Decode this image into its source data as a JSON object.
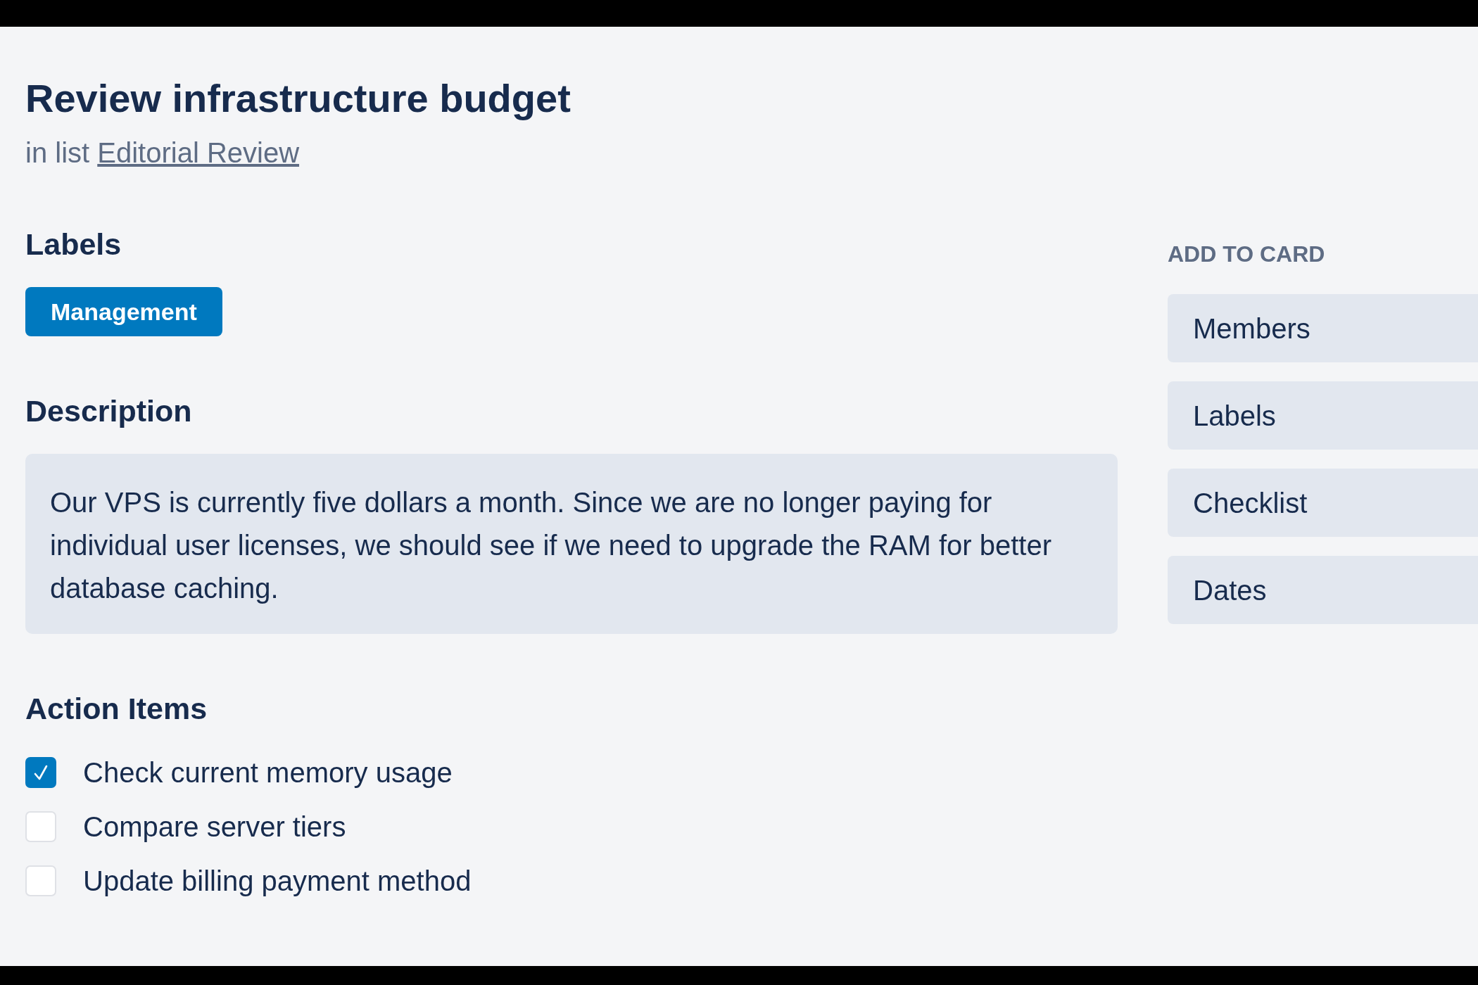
{
  "card": {
    "title": "Review infrastructure budget",
    "list_text": "in list",
    "list_link": "Editorial Review"
  },
  "labels": {
    "heading": "Labels",
    "items": [
      {
        "text": "Management",
        "color": "#0079bf"
      }
    ]
  },
  "description": {
    "heading": "Description",
    "text": "Our VPS is currently five dollars a month. Since we are no longer paying for individual user licenses, we should see if we need to upgrade the RAM for better database caching."
  },
  "action_items": {
    "heading": "Action Items",
    "items": [
      {
        "text": "Check current memory usage",
        "checked": true
      },
      {
        "text": "Compare server tiers",
        "checked": false
      },
      {
        "text": "Update billing payment method",
        "checked": false
      }
    ]
  },
  "add_to_card": {
    "heading": "ADD TO CARD",
    "buttons": [
      "Members",
      "Labels",
      "Checklist",
      "Dates"
    ]
  }
}
